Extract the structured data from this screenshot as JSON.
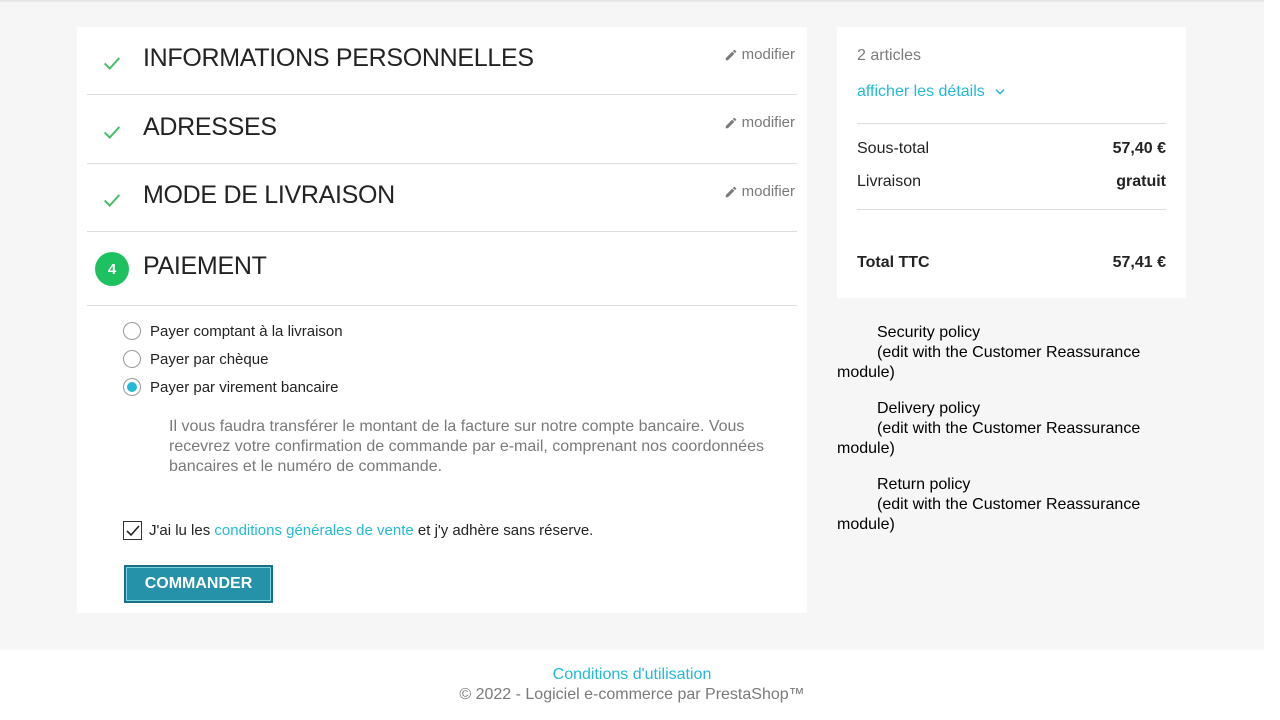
{
  "steps": [
    {
      "title": "Informations personnelles",
      "edit": "modifier",
      "status": "complete"
    },
    {
      "title": "Adresses",
      "edit": "modifier",
      "status": "complete"
    },
    {
      "title": "Mode de livraison",
      "edit": "modifier",
      "status": "complete"
    },
    {
      "title": "Paiement",
      "number": "4",
      "status": "current"
    }
  ],
  "payment": {
    "options": [
      {
        "label": "Payer comptant à la livraison",
        "selected": false
      },
      {
        "label": "Payer par chèque",
        "selected": false
      },
      {
        "label": "Payer par virement bancaire",
        "selected": true
      }
    ],
    "info": "Il vous faudra transférer le montant de la facture sur notre compte bancaire. Vous recevrez votre confirmation de commande par e-mail, comprenant nos coordonnées bancaires et le numéro de commande.",
    "terms_prefix": "J'ai lu les",
    "terms_link": "conditions générales de vente",
    "terms_suffix": "et j'y adhère sans réserve.",
    "terms_checked": true,
    "order_button": "Commander"
  },
  "summary": {
    "count": "2 articles",
    "details_link": "afficher les détails",
    "subtotal_label": "Sous-total",
    "subtotal_value": "57,40 €",
    "shipping_label": "Livraison",
    "shipping_value": "gratuit",
    "total_label": "Total TTC",
    "total_value": "57,41 €"
  },
  "reassurance": [
    {
      "title": "Security policy",
      "desc": "(edit with the Customer Reassurance module)"
    },
    {
      "title": "Delivery policy",
      "desc": "(edit with the Customer Reassurance module)"
    },
    {
      "title": "Return policy",
      "desc": "(edit with the Customer Reassurance module)"
    }
  ],
  "footer": {
    "link": "Conditions d'utilisation",
    "copyright": "© 2022 - Logiciel e-commerce par PrestaShop™"
  },
  "colors": {
    "accent": "#24b9d7",
    "success": "#1ec15f",
    "button": "#2592a9"
  }
}
